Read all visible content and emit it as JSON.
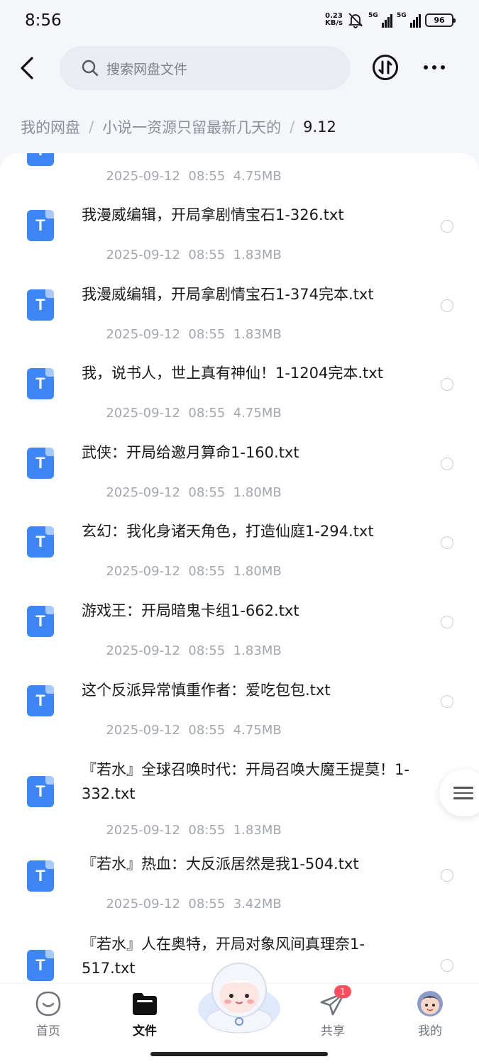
{
  "status": {
    "time": "8:56",
    "net_speed_value": "0.23",
    "net_speed_unit": "KB/s",
    "sim1": "5G",
    "sim2": "5G",
    "battery": "96"
  },
  "header": {
    "search_placeholder": "搜索网盘文件"
  },
  "breadcrumb": {
    "root": "我的网盘",
    "sep": "/",
    "folder": "小说一资源只留最新几天的",
    "current": "9.12"
  },
  "files": [
    {
      "name": "",
      "date": "2025-09-12",
      "time": "08:55",
      "size": "4.75MB"
    },
    {
      "name": "我漫威编辑，开局拿剧情宝石1-326.txt",
      "date": "2025-09-12",
      "time": "08:55",
      "size": "1.83MB"
    },
    {
      "name": "我漫威编辑，开局拿剧情宝石1-374完本.txt",
      "date": "2025-09-12",
      "time": "08:55",
      "size": "1.83MB"
    },
    {
      "name": "我，说书人，世上真有神仙！1-1204完本.txt",
      "date": "2025-09-12",
      "time": "08:55",
      "size": "4.75MB"
    },
    {
      "name": "武侠：开局给邀月算命1-160.txt",
      "date": "2025-09-12",
      "time": "08:55",
      "size": "1.80MB"
    },
    {
      "name": "玄幻：我化身诸天角色，打造仙庭1-294.txt",
      "date": "2025-09-12",
      "time": "08:55",
      "size": "1.80MB"
    },
    {
      "name": "游戏王：开局暗鬼卡组1-662.txt",
      "date": "2025-09-12",
      "time": "08:55",
      "size": "1.83MB"
    },
    {
      "name": "这个反派异常慎重作者：爱吃包包.txt",
      "date": "2025-09-12",
      "time": "08:55",
      "size": "4.75MB"
    },
    {
      "name": "『若水』全球召唤时代：开局召唤大魔王提莫！1-332.txt",
      "date": "2025-09-12",
      "time": "08:55",
      "size": "1.83MB"
    },
    {
      "name": "『若水』热血：大反派居然是我1-504.txt",
      "date": "2025-09-12",
      "time": "08:55",
      "size": "3.42MB"
    },
    {
      "name": "『若水』人在奥特，开局对象风间真理奈1-517.txt",
      "date": "",
      "time": "",
      "size": ""
    }
  ],
  "file_icon_letter": "T",
  "nav": {
    "home": "首页",
    "files": "文件",
    "share": "共享",
    "share_badge": "1",
    "mine": "我的"
  },
  "colors": {
    "accent": "#3e86f5",
    "badge": "#ff4d5e"
  }
}
